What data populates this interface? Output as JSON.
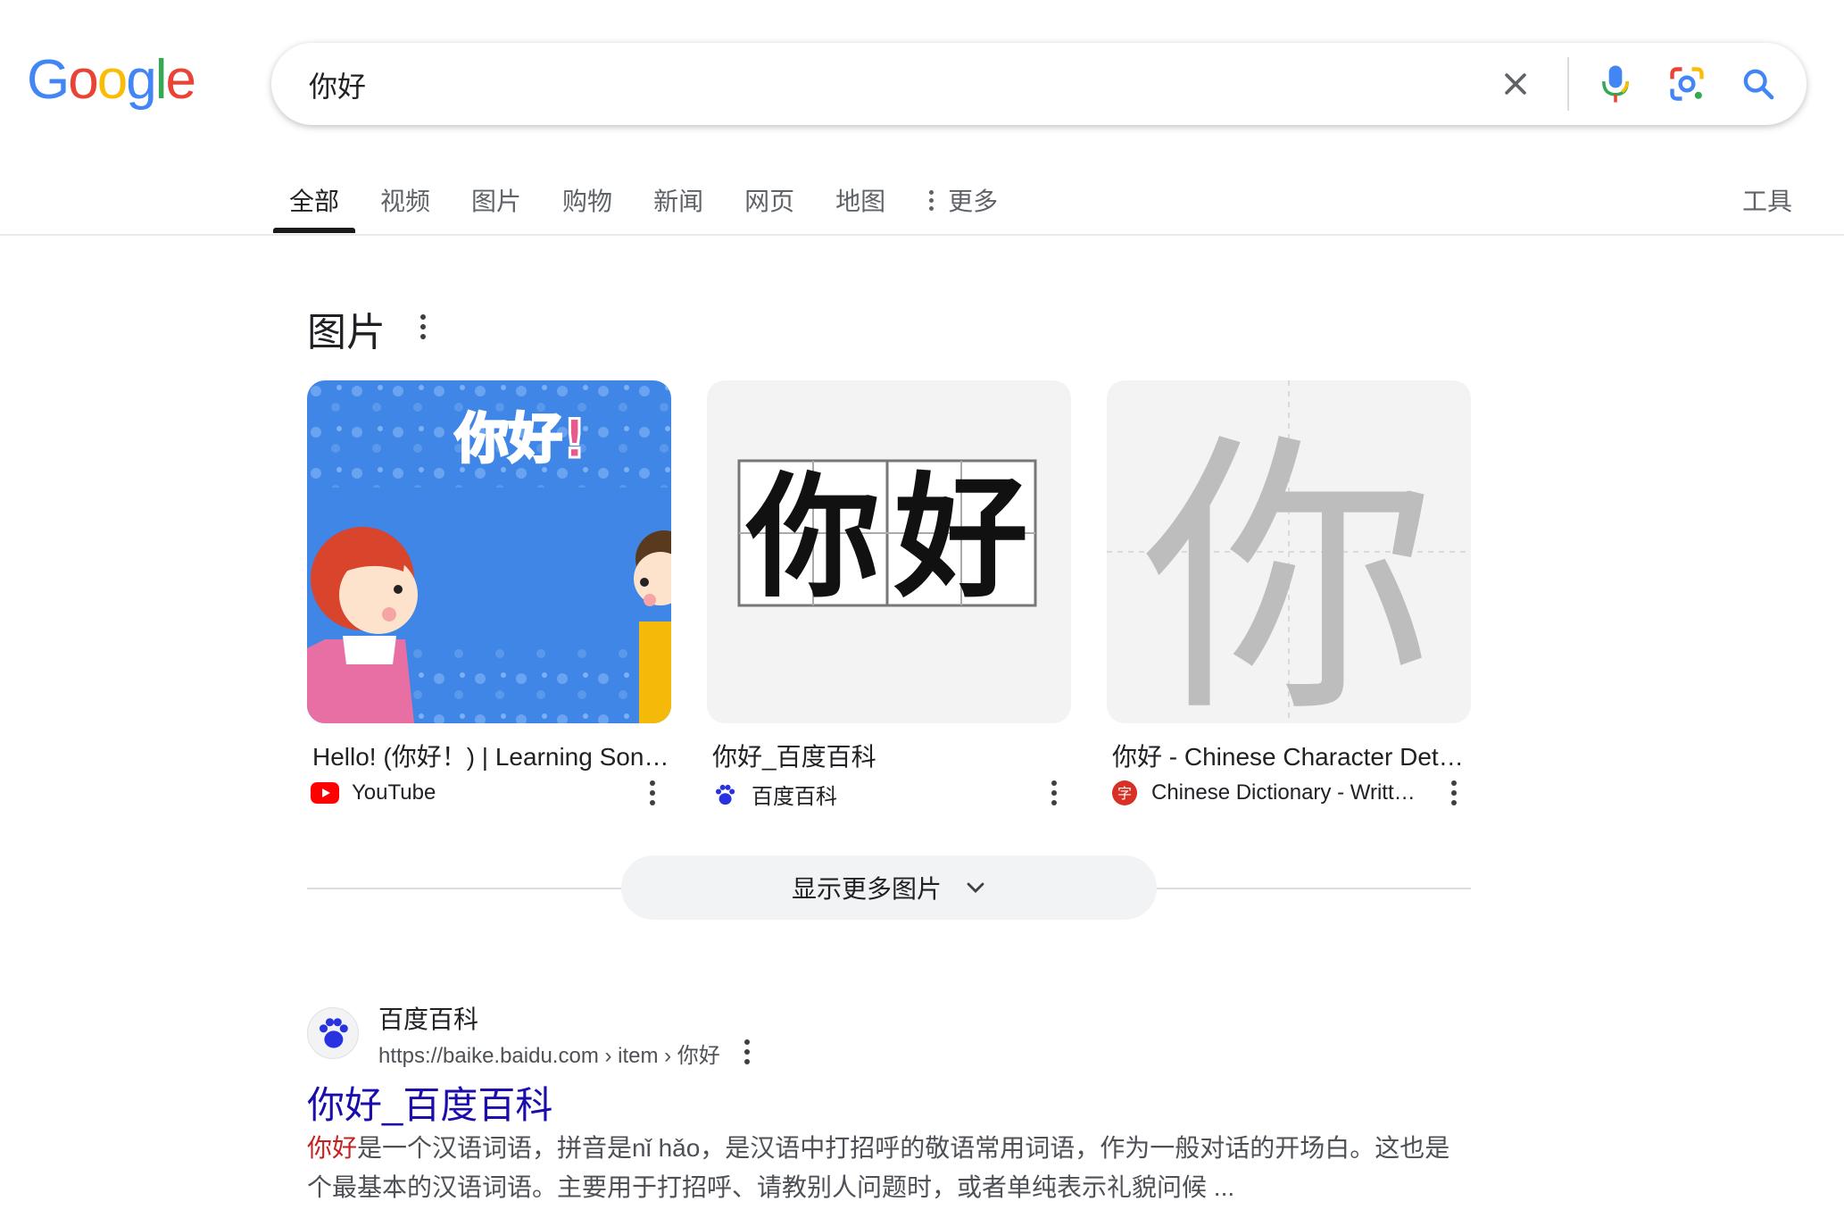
{
  "logo": {
    "text": "Google"
  },
  "search": {
    "query": "你好",
    "icons": [
      "clear-icon",
      "microphone-icon",
      "lens-camera-icon",
      "search-icon"
    ]
  },
  "tabs": [
    {
      "label": "全部",
      "active": true
    },
    {
      "label": "视频"
    },
    {
      "label": "图片"
    },
    {
      "label": "购物"
    },
    {
      "label": "新闻"
    },
    {
      "label": "网页"
    },
    {
      "label": "地图"
    }
  ],
  "more_tab": {
    "label": "更多"
  },
  "tools_label": "工具",
  "images_section": {
    "title": "图片",
    "cards": [
      {
        "title": "Hello! (你好！) | Learning Songs for Kids",
        "source": "YouTube",
        "thumb_text": "你好!"
      },
      {
        "title": "你好_百度百科",
        "source": "百度百科",
        "thumb_chars": [
          "你",
          "好"
        ]
      },
      {
        "title": "你好 - Chinese Character Detail Page",
        "source": "Chinese Dictionary - Written Chinese",
        "thumb_char": "你"
      }
    ],
    "more_button": "显示更多图片"
  },
  "result": {
    "site_name": "百度百科",
    "url": "https://baike.baidu.com › item › 你好",
    "title": "你好_百度百科",
    "snippet_highlight": "你好",
    "snippet_rest": "是一个汉语词语，拼音是nǐ hǎo，是汉语中打招呼的敬语常用词语，作为一般对话的开场白。这也是个最基本的汉语词语。主要用于打招呼、请教别人问题时，或者单纯表示礼貌问候 ..."
  },
  "colors": {
    "link": "#1a0dab",
    "highlight": "#c5221f",
    "google_blue": "#4285f4",
    "google_red": "#ea4335",
    "google_yellow": "#fbbc05",
    "google_green": "#34a853"
  }
}
